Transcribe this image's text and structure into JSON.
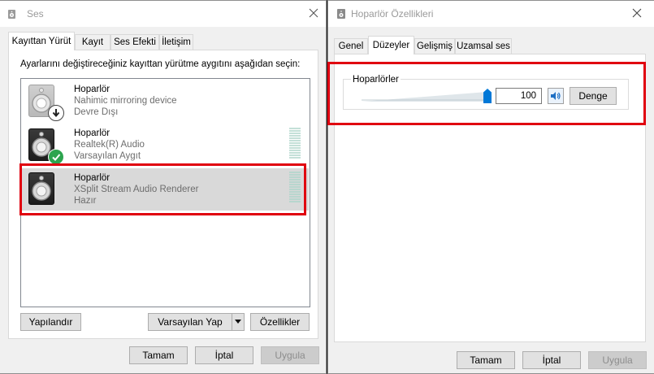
{
  "left_window": {
    "title": "Ses",
    "tabs": [
      {
        "label": "Kayıttan Yürüt"
      },
      {
        "label": "Kayıt"
      },
      {
        "label": "Ses Efekti"
      },
      {
        "label": "İletişim"
      }
    ],
    "instruction": "Ayarlarını değiştireceğiniz kayıttan yürütme aygıtını aşağıdan seçin:",
    "devices": [
      {
        "name": "Hoparlör",
        "line1": "Nahimic mirroring device",
        "line2": "Devre Dışı",
        "badge_icon": "arrow-down-icon"
      },
      {
        "name": "Hoparlör",
        "line1": "Realtek(R) Audio",
        "line2": "Varsayılan Aygıt",
        "badge_icon": "check-icon"
      },
      {
        "name": "Hoparlör",
        "line1": "XSplit  Stream  Audio  Renderer",
        "line2": "Hazır",
        "selected": true
      }
    ],
    "buttons": {
      "configure": "Yapılandır",
      "set_default": "Varsayılan Yap",
      "properties": "Özellikler",
      "ok": "Tamam",
      "cancel": "İptal",
      "apply": "Uygula"
    }
  },
  "right_window": {
    "title": "Hoparlör Özellikleri",
    "tabs": [
      {
        "label": "Genel"
      },
      {
        "label": "Düzeyler"
      },
      {
        "label": "Gelişmiş"
      },
      {
        "label": "Uzamsal ses"
      }
    ],
    "group_label": "Hoparlörler",
    "volume": {
      "value": "100",
      "level_fraction": 1.0
    },
    "balance_button": "Denge",
    "buttons": {
      "ok": "Tamam",
      "cancel": "İptal",
      "apply": "Uygula"
    }
  },
  "colors": {
    "highlight_red": "#e0000f",
    "selected_row": "#d9d9d9",
    "accent_blue": "#0078d7",
    "check_green": "#2da44e"
  }
}
